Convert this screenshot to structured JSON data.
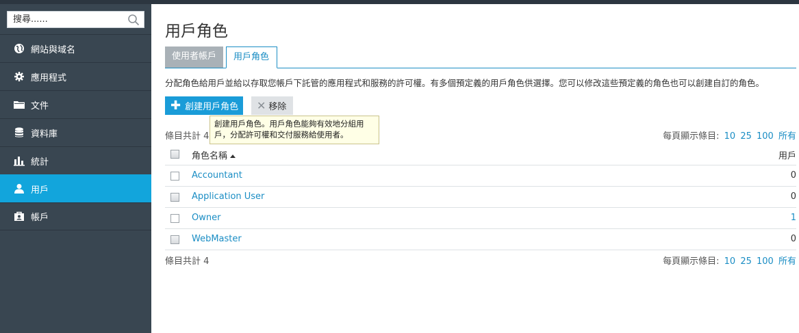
{
  "search": {
    "placeholder": "搜尋......"
  },
  "sidebar": {
    "items": [
      {
        "label": "網站與域名",
        "icon": "globe-icon",
        "active": false
      },
      {
        "label": "應用程式",
        "icon": "gear-icon",
        "active": false
      },
      {
        "label": "文件",
        "icon": "folder-icon",
        "active": false
      },
      {
        "label": "資料庫",
        "icon": "database-icon",
        "active": false
      },
      {
        "label": "統計",
        "icon": "bar-chart-icon",
        "active": false
      },
      {
        "label": "用戶",
        "icon": "user-icon",
        "active": true
      },
      {
        "label": "帳戶",
        "icon": "briefcase-icon",
        "active": false
      }
    ]
  },
  "page": {
    "title": "用戶角色",
    "tabs": [
      {
        "label": "使用者帳戶",
        "active": false
      },
      {
        "label": "用戶角色",
        "active": true
      }
    ],
    "description": "分配角色給用戶並給以存取您帳戶下託管的應用程式和服務的許可權。有多個預定義的用戶角色供選擇。您可以修改這些預定義的角色也可以創建自訂的角色。"
  },
  "toolbar": {
    "create_label": "創建用戶角色",
    "remove_label": "移除",
    "tooltip": "創建用戶角色。用戶角色能夠有效地分組用戶，分配許可權和交付服務給使用者。"
  },
  "list": {
    "count_label": "條目共計 4",
    "per_page_label": "每頁顯示條目:",
    "per_page_options": [
      "10",
      "25",
      "100",
      "所有"
    ],
    "columns": {
      "name": "角色名稱",
      "users": "用戶"
    },
    "rows": [
      {
        "name": "Accountant",
        "users": "0"
      },
      {
        "name": "Application User",
        "users": "0"
      },
      {
        "name": "Owner",
        "users": "1"
      },
      {
        "name": "WebMaster",
        "users": "0"
      }
    ]
  },
  "colors": {
    "accent": "#1a9cd8",
    "sidebar_bg": "#394651",
    "sidebar_active": "#12a5dc"
  }
}
